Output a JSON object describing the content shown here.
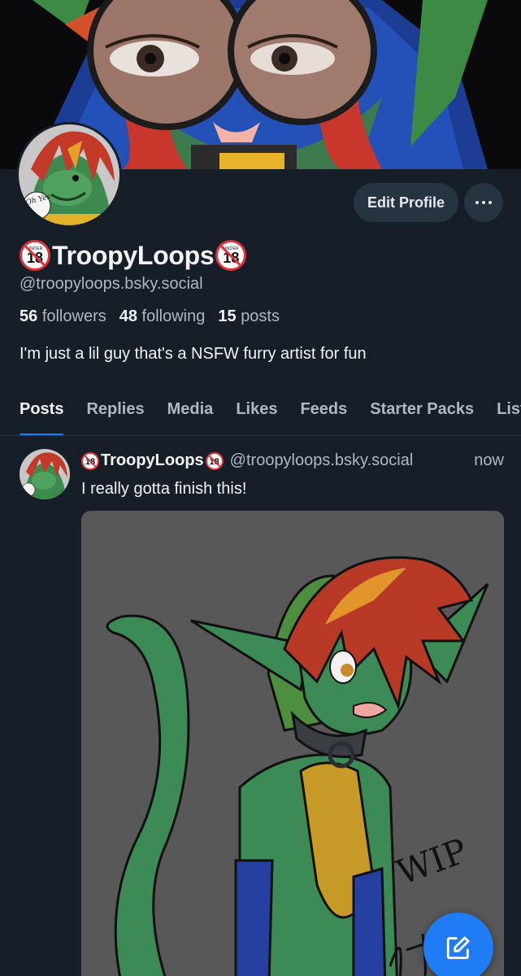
{
  "banner": {
    "alt_icon": "banner-image"
  },
  "profile": {
    "display_name": "TroopyLoops",
    "badge_number": "18",
    "badge_label": "UNDER",
    "handle": "@troopyloops.bsky.social",
    "avatar_badge_text": "Oh Yes",
    "edit_label": "Edit Profile",
    "stats": {
      "followers_count": "56",
      "followers_label": "followers",
      "following_count": "48",
      "following_label": "following",
      "posts_count": "15",
      "posts_label": "posts"
    },
    "bio": "I'm just a lil guy that's a NSFW furry artist for fun"
  },
  "tabs": [
    "Posts",
    "Replies",
    "Media",
    "Likes",
    "Feeds",
    "Starter Packs",
    "Lists"
  ],
  "post": {
    "author": "TroopyLoops",
    "handle": "@troopyloops.bsky.social",
    "time": "now",
    "text": "I really gotta finish this!",
    "image_caption": "WIP"
  },
  "colors": {
    "background": "#161e27",
    "accent": "#1083fe",
    "button_bg": "#263340",
    "muted_text": "#aeb8c4"
  }
}
